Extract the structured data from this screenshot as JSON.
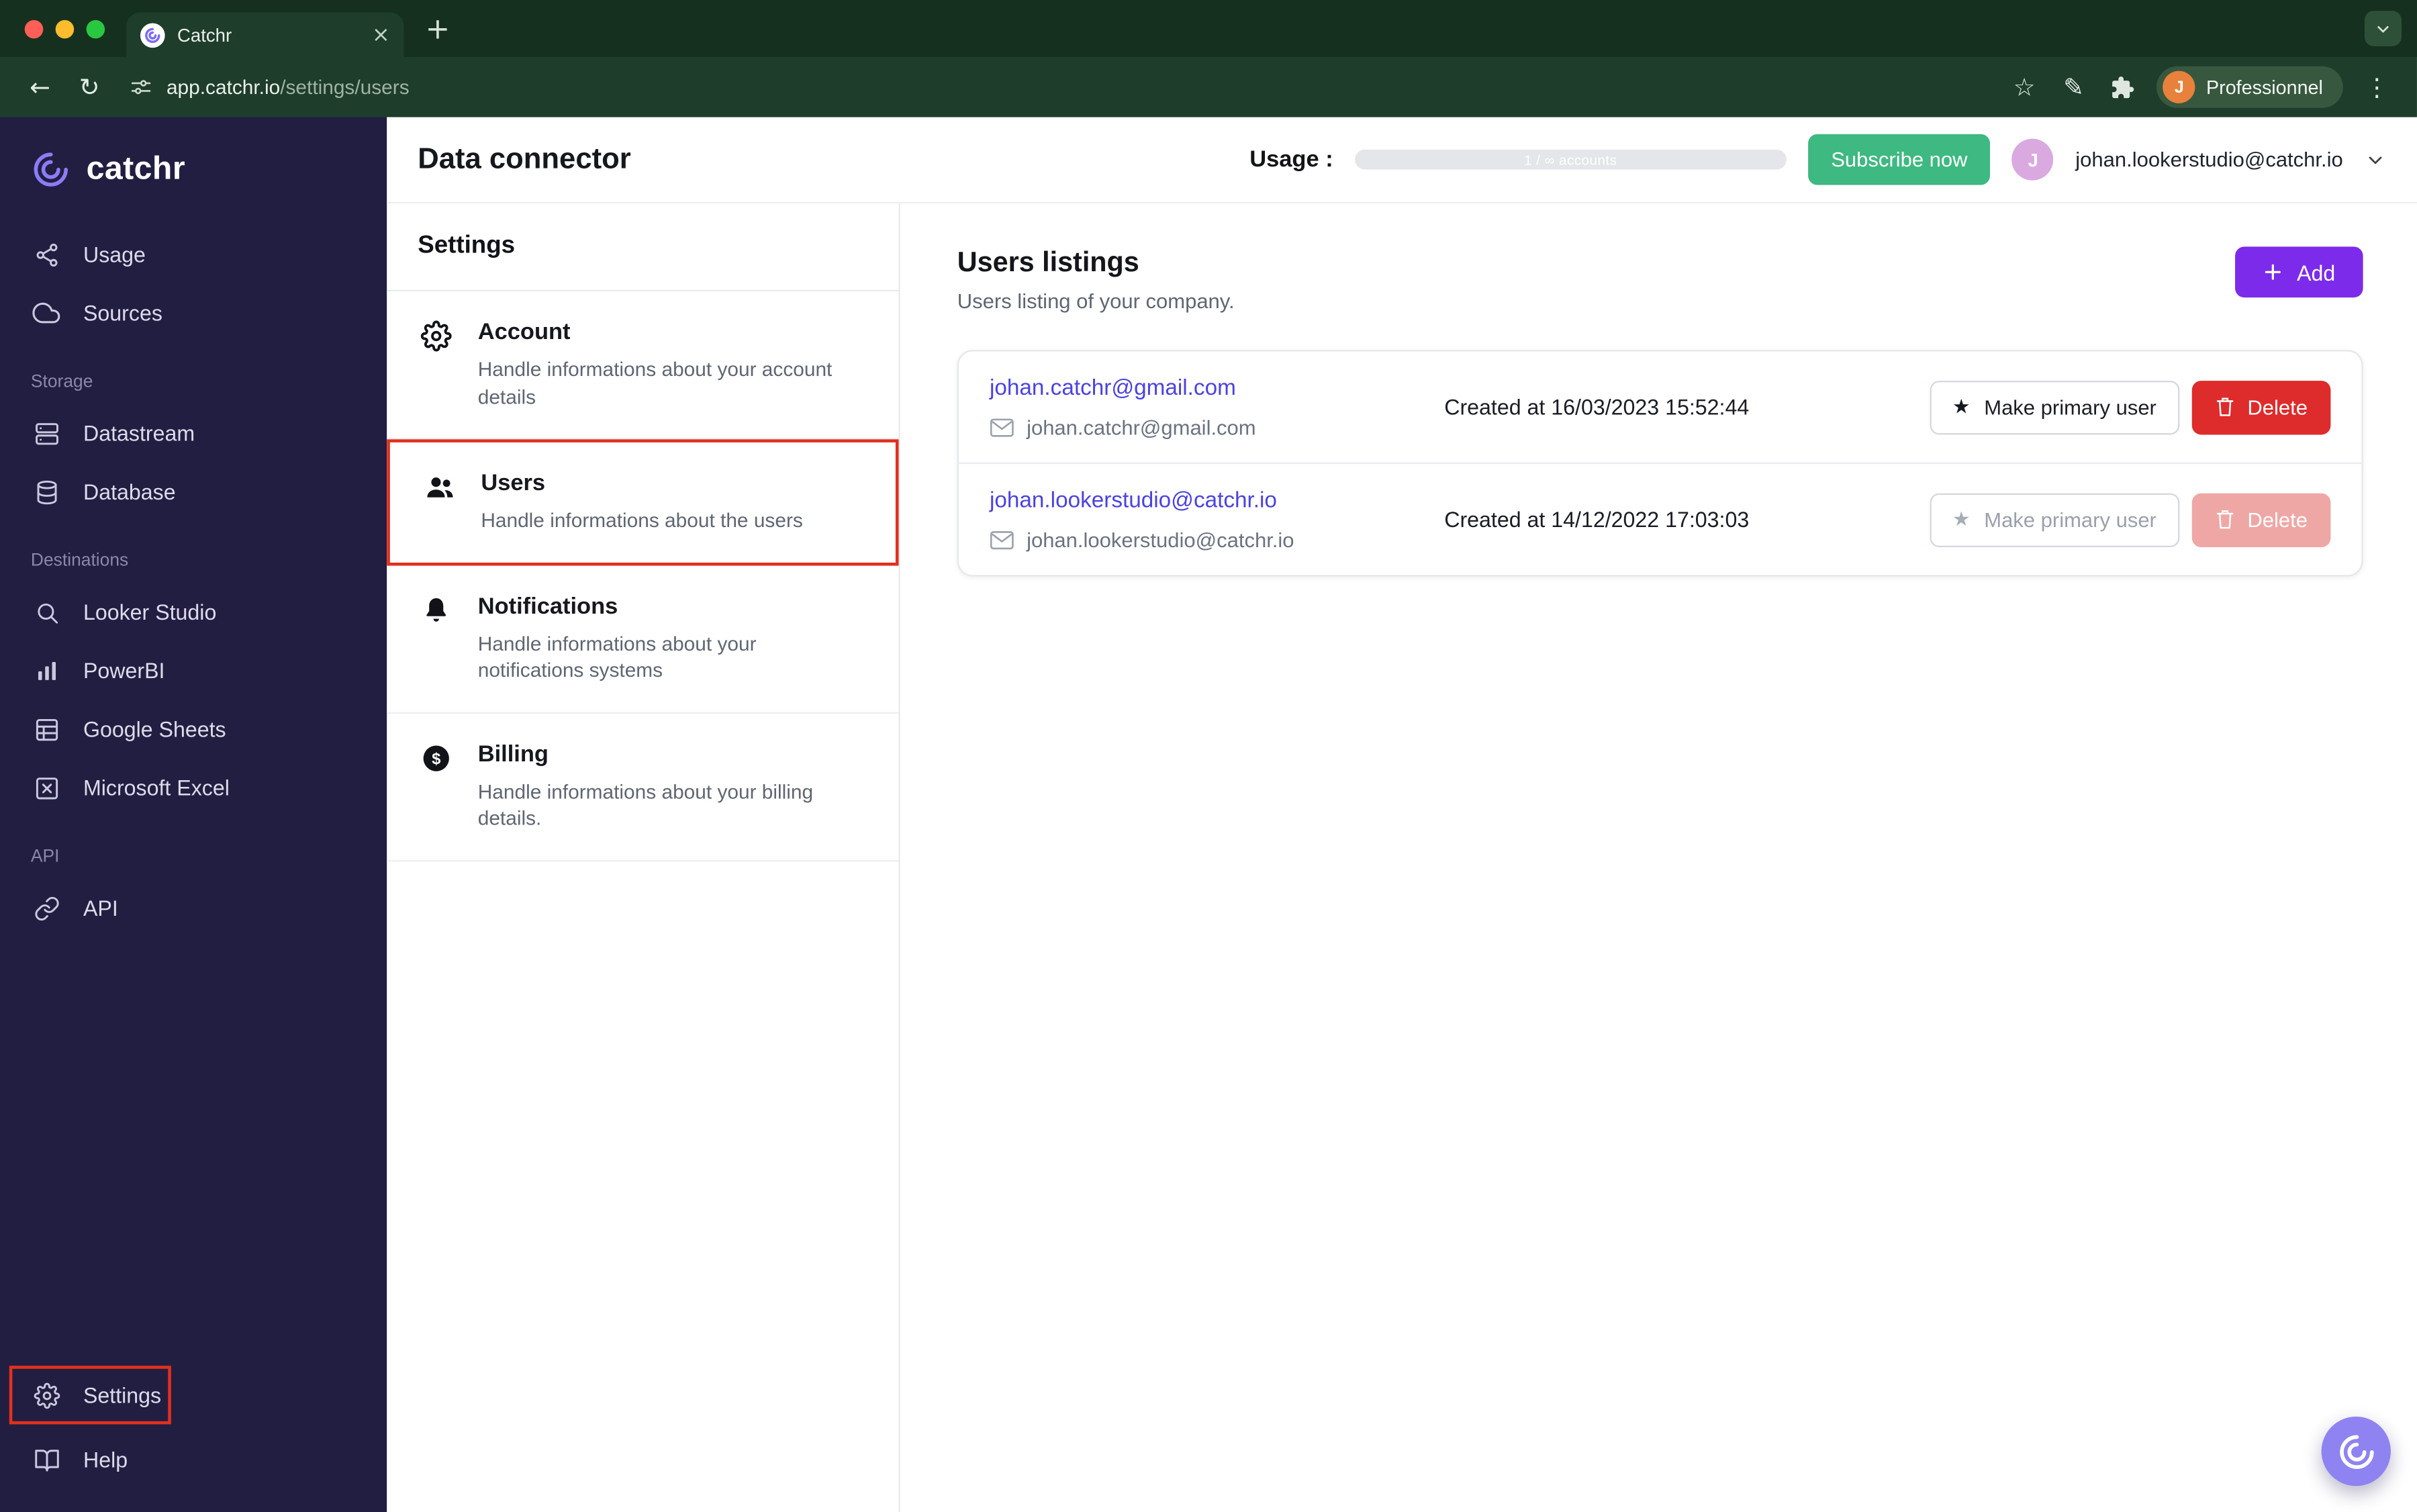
{
  "colors": {
    "accent_purple": "#7C2BEA",
    "link_purple": "#4B43DF",
    "subscribe_green": "#3EB981",
    "delete_red": "#DE2B2B",
    "annotation_red": "#E2301D",
    "sidebar_bg": "#221E42",
    "chrome_green": "#1E3D2B"
  },
  "icons": {
    "close": "×",
    "new_tab": "+",
    "back": "←",
    "reload": "↻",
    "bookmark": "☆",
    "edit": "✎",
    "overflow": "⋮",
    "star": "★"
  },
  "browser": {
    "tab": {
      "title": "Catchr"
    },
    "url": {
      "domain": "app.catchr.io",
      "path": "/settings/users"
    },
    "profile": {
      "name": "Professionnel",
      "initial": "J"
    }
  },
  "app_header": {
    "title": "Data connector",
    "usage_label": "Usage :",
    "usage_value": "1 / ∞ accounts",
    "subscribe": "Subscribe now",
    "avatar_initial": "J",
    "account_email": "johan.lookerstudio@catchr.io"
  },
  "sidebar": {
    "brand": "catchr",
    "primary_items": [
      {
        "label": "Usage",
        "icon": "share-icon"
      },
      {
        "label": "Sources",
        "icon": "cloud-icon"
      }
    ],
    "storage_section": {
      "label": "Storage",
      "items": [
        {
          "label": "Datastream",
          "icon": "server-icon"
        },
        {
          "label": "Database",
          "icon": "database-icon"
        }
      ]
    },
    "destinations_section": {
      "label": "Destinations",
      "items": [
        {
          "label": "Looker Studio",
          "icon": "looker-icon"
        },
        {
          "label": "PowerBI",
          "icon": "bar-chart-icon"
        },
        {
          "label": "Google Sheets",
          "icon": "table-icon"
        },
        {
          "label": "Microsoft Excel",
          "icon": "excel-icon"
        }
      ]
    },
    "api_section": {
      "label": "API",
      "items": [
        {
          "label": "API",
          "icon": "link-icon"
        }
      ]
    },
    "bottom_items": [
      {
        "label": "Settings",
        "icon": "gear-icon"
      },
      {
        "label": "Help",
        "icon": "book-icon"
      }
    ]
  },
  "settings_nav": {
    "title": "Settings",
    "items": [
      {
        "title": "Account",
        "description": "Handle informations about your account details",
        "icon": "gear-icon"
      },
      {
        "title": "Users",
        "description": "Handle informations about the users",
        "icon": "users-icon"
      },
      {
        "title": "Notifications",
        "description": "Handle informations about your notifications systems",
        "icon": "bell-icon"
      },
      {
        "title": "Billing",
        "description": "Handle informations about your billing details.",
        "icon": "dollar-icon"
      }
    ]
  },
  "main": {
    "title": "Users listings",
    "subtitle": "Users listing of your company.",
    "add_button": "Add",
    "users": [
      {
        "link": "johan.catchr@gmail.com",
        "email": "johan.catchr@gmail.com",
        "created": "Created at 16/03/2023 15:52:44",
        "primary_button": "Make primary user",
        "delete_button": "Delete"
      },
      {
        "link": "johan.lookerstudio@catchr.io",
        "email": "johan.lookerstudio@catchr.io",
        "created": "Created at 14/12/2022 17:03:03",
        "primary_button": "Make primary user",
        "delete_button": "Delete"
      }
    ]
  }
}
